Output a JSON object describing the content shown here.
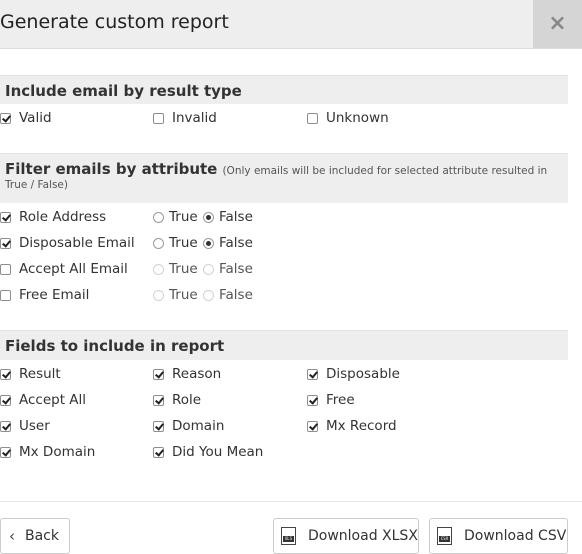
{
  "header": {
    "title": "Generate custom report",
    "close_label": "×"
  },
  "result_type": {
    "heading": "Include email by result type",
    "options": [
      {
        "label": "Valid",
        "checked": true
      },
      {
        "label": "Invalid",
        "checked": false
      },
      {
        "label": "Unknown",
        "checked": false
      }
    ]
  },
  "attribute": {
    "heading": "Filter emails by attribute",
    "note_part1": "(Only emails will be included for selected attribute resulted in",
    "note_part2": "True / False)",
    "true_label": "True",
    "false_label": "False",
    "rows": [
      {
        "label": "Role Address",
        "checked": true,
        "value": "False"
      },
      {
        "label": "Disposable Email",
        "checked": true,
        "value": "False"
      },
      {
        "label": "Accept All Email",
        "checked": false,
        "value": null
      },
      {
        "label": "Free Email",
        "checked": false,
        "value": null
      }
    ]
  },
  "fields": {
    "heading": "Fields to include in report",
    "items": [
      {
        "label": "Result",
        "checked": true
      },
      {
        "label": "Reason",
        "checked": true
      },
      {
        "label": "Disposable",
        "checked": true
      },
      {
        "label": "Accept All",
        "checked": true
      },
      {
        "label": "Role",
        "checked": true
      },
      {
        "label": "Free",
        "checked": true
      },
      {
        "label": "User",
        "checked": true
      },
      {
        "label": "Domain",
        "checked": true
      },
      {
        "label": "Mx Record",
        "checked": true
      },
      {
        "label": "Mx Domain",
        "checked": true
      },
      {
        "label": "Did You Mean",
        "checked": true
      }
    ]
  },
  "footer": {
    "back_label": "Back",
    "download_xlsx_label": "Download XLSX",
    "download_csv_label": "Download CSV",
    "xlsx_tag": "XLS",
    "csv_tag": "CSV"
  }
}
